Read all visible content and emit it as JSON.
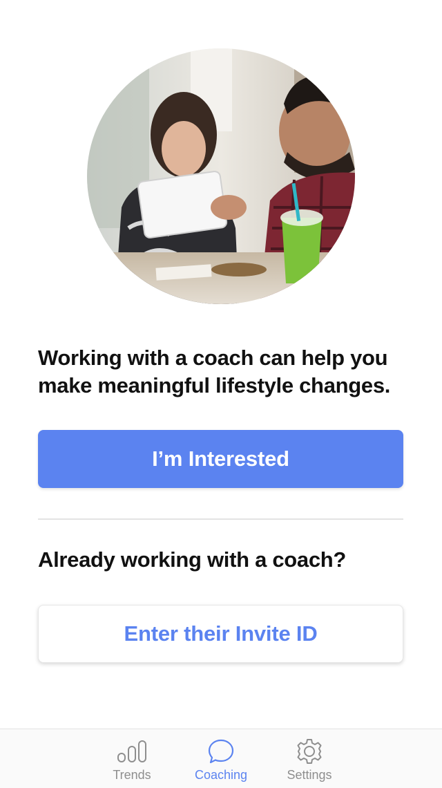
{
  "main": {
    "headline": "Working with a coach can help you make meaningful lifestyle changes.",
    "primary_button": "I’m Interested",
    "subheadline": "Already working with a coach?",
    "secondary_button": "Enter their Invite ID"
  },
  "tabbar": {
    "tabs": [
      {
        "label": "Trends",
        "icon": "bar-chart-icon",
        "active": false
      },
      {
        "label": "Coaching",
        "icon": "chat-bubble-icon",
        "active": true
      },
      {
        "label": "Settings",
        "icon": "gear-icon",
        "active": false
      }
    ]
  },
  "colors": {
    "accent": "#5b83f0",
    "inactive_tab": "#8e8e8e",
    "text": "#111111"
  }
}
